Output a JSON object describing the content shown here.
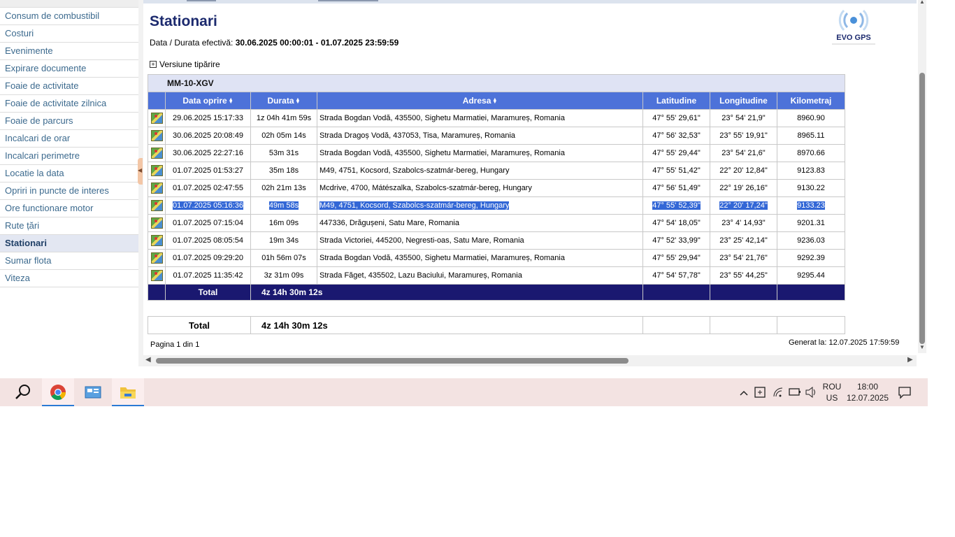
{
  "sidebar": {
    "items": [
      {
        "label": "Consum de combustibil"
      },
      {
        "label": "Costuri"
      },
      {
        "label": "Evenimente"
      },
      {
        "label": "Expirare documente"
      },
      {
        "label": "Foaie de activitate"
      },
      {
        "label": "Foaie de activitate zilnica"
      },
      {
        "label": "Foaie de parcurs"
      },
      {
        "label": "Incalcari de orar"
      },
      {
        "label": "Incalcari perimetre"
      },
      {
        "label": "Locatie la data"
      },
      {
        "label": "Opriri in puncte de interes"
      },
      {
        "label": "Ore functionare motor"
      },
      {
        "label": "Rute țări"
      },
      {
        "label": "Stationari",
        "active": true
      },
      {
        "label": "Sumar flota"
      },
      {
        "label": "Viteza"
      }
    ]
  },
  "report": {
    "title": "Stationari",
    "period_label": "Data / Durata efectivă:",
    "period_value": "30.06.2025 00:00:01 - 01.07.2025 23:59:59",
    "print_label": "Versiune tipărire",
    "logo_text": "EVO GPS",
    "vehicle": "MM-10-XGV",
    "columns": [
      "Data oprire",
      "Durata",
      "Adresa",
      "Latitudine",
      "Longitudine",
      "Kilometraj"
    ],
    "rows": [
      {
        "date": "29.06.2025 15:17:33",
        "duration": "1z 04h 41m 59s",
        "address": "Strada Bogdan Vodă,  435500, Sighetu Marmatiei, Maramureș, Romania",
        "lat": "47° 55' 29,61\"",
        "lon": "23° 54' 21,9\"",
        "km": "8960.90"
      },
      {
        "date": "30.06.2025 20:08:49",
        "duration": "02h 05m 14s",
        "address": "Strada Dragoș Vodă,  437053, Tisa, Maramureș, Romania",
        "lat": "47° 56' 32,53\"",
        "lon": "23° 55' 19,91\"",
        "km": "8965.11"
      },
      {
        "date": "30.06.2025 22:27:16",
        "duration": "53m 31s",
        "address": "Strada Bogdan Vodă,  435500, Sighetu Marmatiei, Maramureș, Romania",
        "lat": "47° 55' 29,44\"",
        "lon": "23° 54' 21,6\"",
        "km": "8970.66"
      },
      {
        "date": "01.07.2025 01:53:27",
        "duration": "35m 18s",
        "address": "M49,  4751, Kocsord, Szabolcs-szatmár-bereg, Hungary",
        "lat": "47° 55' 51,42\"",
        "lon": "22° 20' 12,84\"",
        "km": "9123.83"
      },
      {
        "date": "01.07.2025 02:47:55",
        "duration": "02h 21m 13s",
        "address": "Mcdrive,  4700, Mátészalka, Szabolcs-szatmár-bereg, Hungary",
        "lat": "47° 56' 51,49\"",
        "lon": "22° 19' 26,16\"",
        "km": "9130.22"
      },
      {
        "date": "01.07.2025 05:16:36",
        "duration": "49m 58s",
        "address": "M49,  4751, Kocsord, Szabolcs-szatmár-bereg, Hungary",
        "lat": "47° 55' 52,39\"",
        "lon": "22° 20' 17,24\"",
        "km": "9133.23",
        "selected": true
      },
      {
        "date": "01.07.2025 07:15:04",
        "duration": "16m 09s",
        "address": "447336, Drăgușeni, Satu Mare, Romania",
        "lat": "47° 54' 18,05\"",
        "lon": "23° 4' 14,93\"",
        "km": "9201.31"
      },
      {
        "date": "01.07.2025 08:05:54",
        "duration": "19m 34s",
        "address": "Strada Victoriei,  445200, Negresti-oas, Satu Mare, Romania",
        "lat": "47° 52' 33,99\"",
        "lon": "23° 25' 42,14\"",
        "km": "9236.03"
      },
      {
        "date": "01.07.2025 09:29:20",
        "duration": "01h 56m 07s",
        "address": "Strada Bogdan Vodă,  435500, Sighetu Marmatiei, Maramureș, Romania",
        "lat": "47° 55' 29,94\"",
        "lon": "23° 54' 21,76\"",
        "km": "9292.39"
      },
      {
        "date": "01.07.2025 11:35:42",
        "duration": "3z 31m 09s",
        "address": "Strada Făget,  435502, Lazu Baciului, Maramureș, Romania",
        "lat": "47° 54' 57,78\"",
        "lon": "23° 55' 44,25\"",
        "km": "9295.44"
      }
    ],
    "total_label": "Total",
    "total_value": "4z 14h 30m 12s",
    "summary_total_label": "Total",
    "summary_total_value": "4z 14h 30m 12s",
    "pager": "Pagina 1 din 1",
    "generated": "Generat la: 12.07.2025 17:59:59"
  },
  "taskbar": {
    "lang_top": "ROU",
    "lang_bottom": "US",
    "time": "18:00",
    "date": "12.07.2025"
  }
}
